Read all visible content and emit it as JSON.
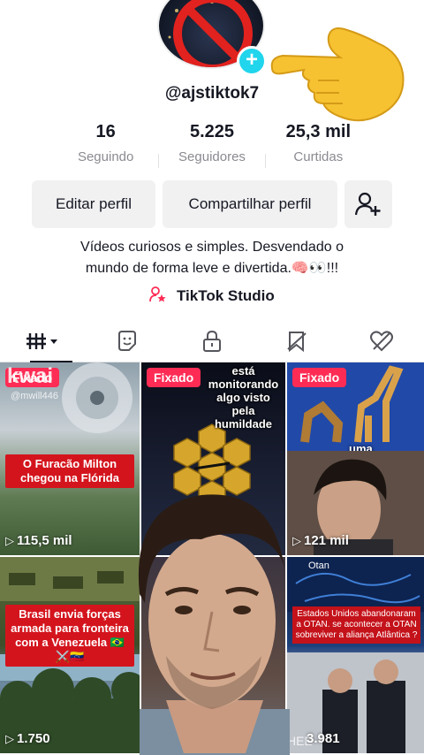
{
  "profile": {
    "username": "@ajstiktok7",
    "avatar_icon": "no-symbol-icon",
    "add_icon": "plus-icon"
  },
  "overlay": {
    "hand_icon": "pointing-hand-emoji"
  },
  "stats": [
    {
      "value": "16",
      "label": "Seguindo"
    },
    {
      "value": "5.225",
      "label": "Seguidores"
    },
    {
      "value": "25,3 mil",
      "label": "Curtidas"
    }
  ],
  "actions": {
    "edit": "Editar perfil",
    "share": "Compartilhar perfil",
    "add_friend_icon": "add-friend-icon"
  },
  "bio": {
    "line1": "Vídeos curiosos e simples. Desvendado o",
    "line2": "mundo de forma leve e divertida.🧠👀!!!"
  },
  "studio": {
    "label": "TikTok Studio",
    "icon": "studio-person-star-icon"
  },
  "tabs": [
    {
      "name": "videos",
      "icon": "grid-icon",
      "active": true
    },
    {
      "name": "reposts",
      "icon": "repost-icon",
      "active": false
    },
    {
      "name": "private",
      "icon": "lock-icon",
      "active": false
    },
    {
      "name": "favorites",
      "icon": "bookmark-icon",
      "active": false
    },
    {
      "name": "liked",
      "icon": "heart-hidden-icon",
      "active": false
    }
  ],
  "videos": [
    {
      "pinned": "Fixado",
      "watermark": "kwai",
      "watermark_sub": "@mwill446",
      "caption": "O Furacão Milton chegou na Flórida",
      "views": "115,5 mil"
    },
    {
      "pinned": "Fixado",
      "caption_top": "está monitorando algo visto pela humildade",
      "views": ""
    },
    {
      "pinned": "Fixado",
      "caption_mid": "uma",
      "views": "121 mil"
    },
    {
      "caption": "Brasil envia forças armada para fronteira com a Venezuela 🇧🇷⚔️🇻🇪",
      "views": "1.750"
    },
    {
      "views": ""
    },
    {
      "tag": "Otan",
      "caption": "Estados Unidos abandonaram a OTAN. se  acontecer a OTAN sobreviver a aliança Atlântica ?",
      "views": "3.981",
      "corner": "HEE"
    }
  ],
  "colors": {
    "accent": "#fe2c55",
    "plus": "#20d5ec",
    "caption_red": "#d4141d"
  }
}
